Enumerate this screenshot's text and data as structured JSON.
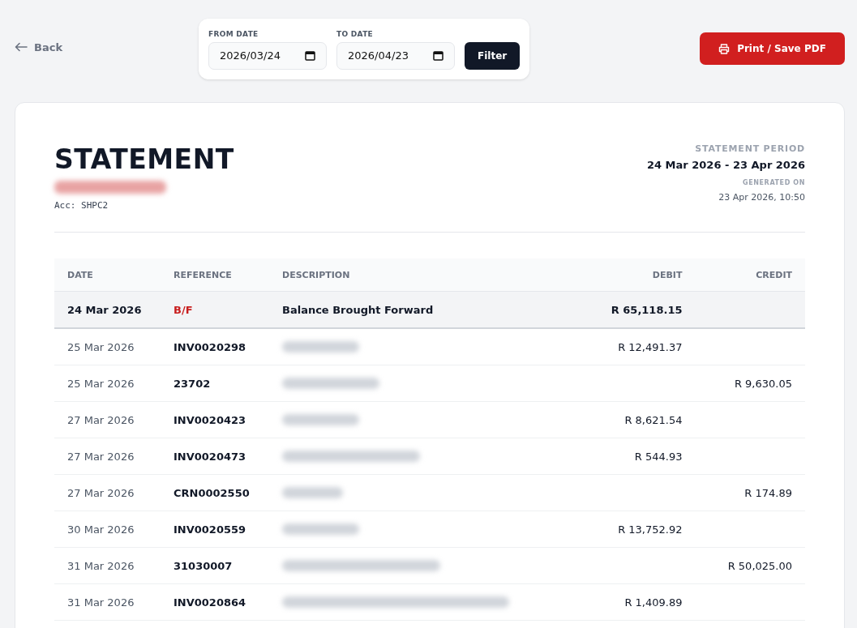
{
  "back": {
    "label": "Back"
  },
  "filter": {
    "from": {
      "label": "FROM DATE",
      "value": "2026/03/24"
    },
    "to": {
      "label": "TO DATE",
      "value": "2026/04/23"
    },
    "button": "Filter"
  },
  "print_button": "Print / Save PDF",
  "statement": {
    "title": "STATEMENT",
    "customer_redacted": true,
    "account": "Acc: SHPC2",
    "period_label": "STATEMENT PERIOD",
    "period": "24 Mar 2026 - 23 Apr 2026",
    "generated_label": "GENERATED ON",
    "generated": "23 Apr 2026, 10:50"
  },
  "table": {
    "columns": [
      "DATE",
      "REFERENCE",
      "DESCRIPTION",
      "DEBIT",
      "CREDIT"
    ],
    "rows": [
      {
        "kind": "brought_forward",
        "date": "24 Mar 2026",
        "reference": "B/F",
        "description": "Balance Brought Forward",
        "debit": "R 65,118.15"
      },
      {
        "kind": "entry",
        "date": "25 Mar 2026",
        "reference": "INV0020298",
        "description_redacted": true,
        "debit": "R 12,491.37"
      },
      {
        "kind": "entry",
        "date": "25 Mar 2026",
        "reference": "23702",
        "description_redacted": true,
        "credit": "R 9,630.05"
      },
      {
        "kind": "entry",
        "date": "27 Mar 2026",
        "reference": "INV0020423",
        "description_redacted": true,
        "debit": "R 8,621.54"
      },
      {
        "kind": "entry",
        "date": "27 Mar 2026",
        "reference": "INV0020473",
        "description_redacted": true,
        "debit": "R 544.93"
      },
      {
        "kind": "entry",
        "date": "27 Mar 2026",
        "reference": "CRN0002550",
        "description_redacted": true,
        "credit": "R 174.89"
      },
      {
        "kind": "entry",
        "date": "30 Mar 2026",
        "reference": "INV0020559",
        "description_redacted": true,
        "debit": "R 13,752.92"
      },
      {
        "kind": "entry",
        "date": "31 Mar 2026",
        "reference": "31030007",
        "description_redacted": true,
        "credit": "R 50,025.00"
      },
      {
        "kind": "entry",
        "date": "31 Mar 2026",
        "reference": "INV0020864",
        "description_redacted": true,
        "debit": "R 1,409.89"
      }
    ]
  }
}
